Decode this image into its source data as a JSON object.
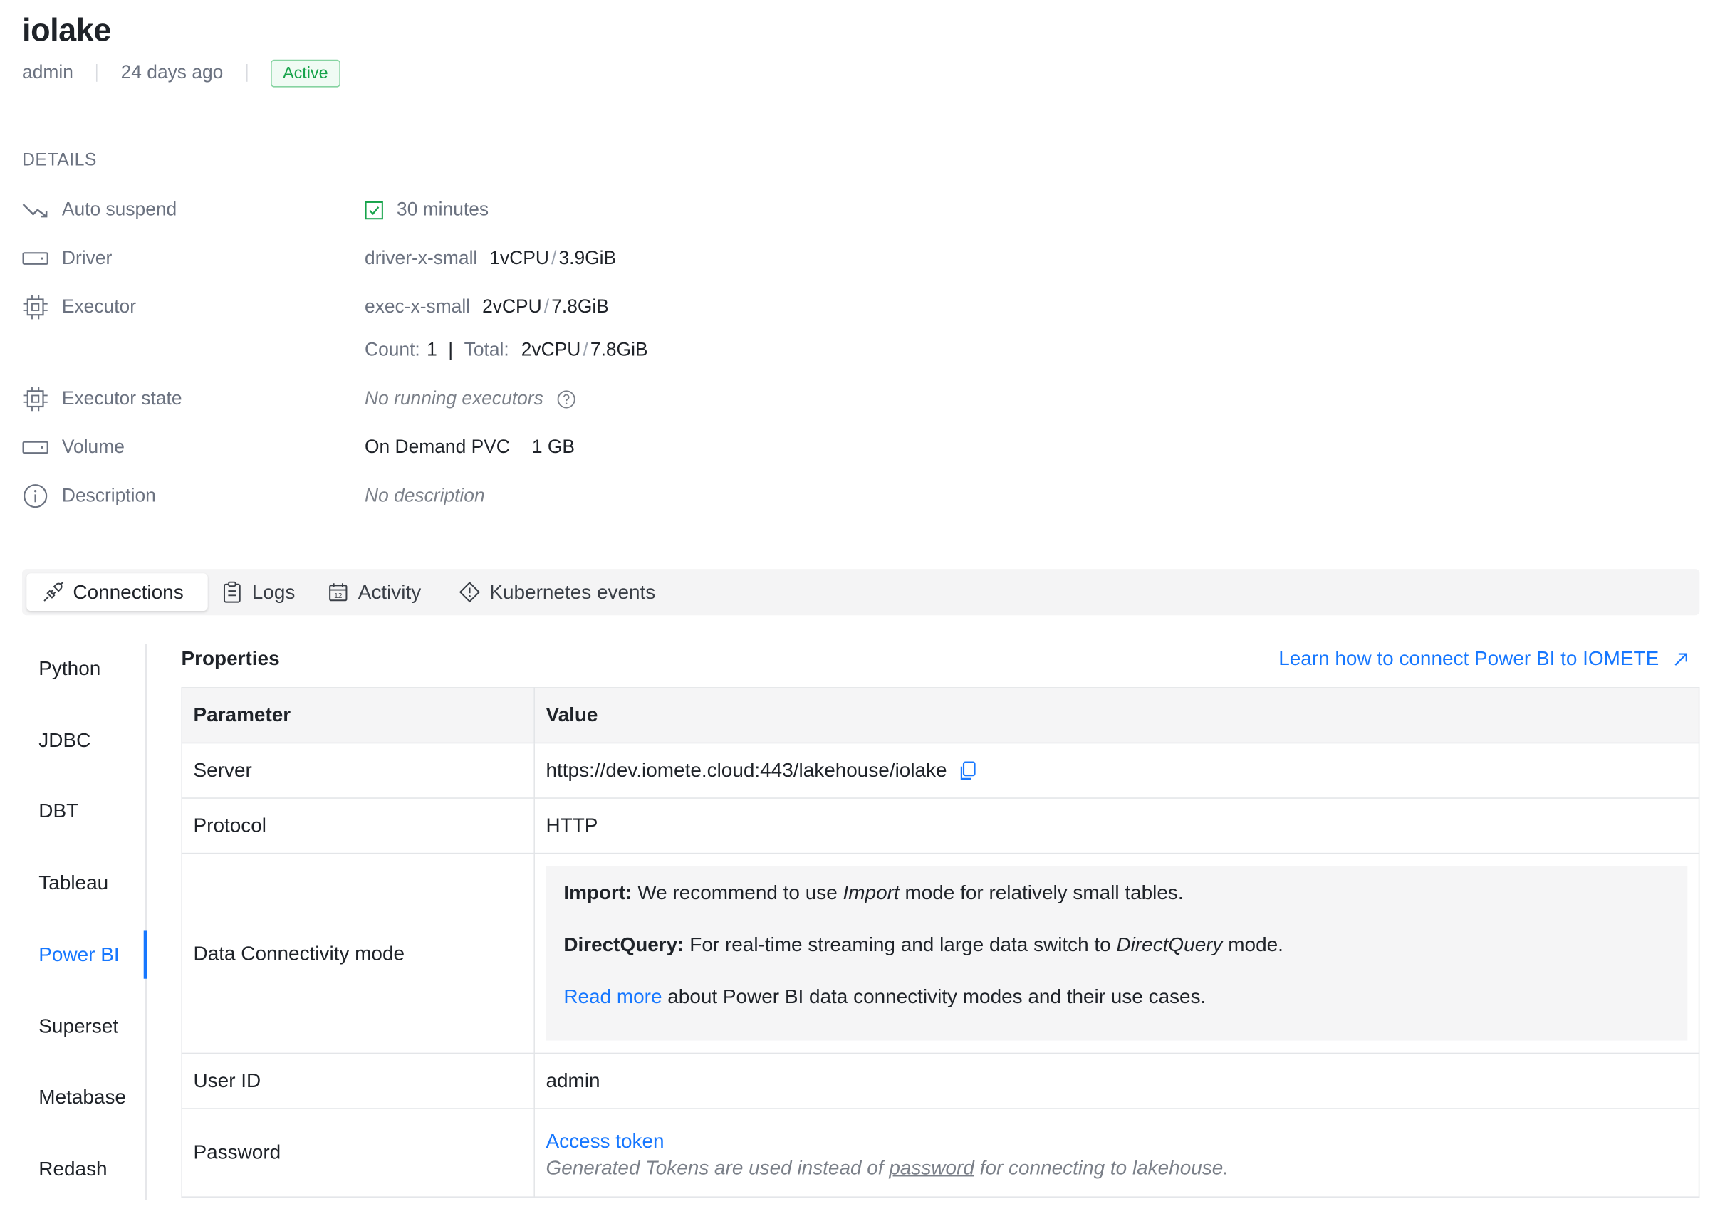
{
  "header": {
    "title": "iolake",
    "owner": "admin",
    "created": "24 days ago",
    "status": "Active"
  },
  "details": {
    "heading": "DETAILS",
    "auto_suspend": {
      "label": "Auto suspend",
      "value": "30 minutes"
    },
    "driver": {
      "label": "Driver",
      "type": "driver-x-small",
      "cpu": "1vCPU",
      "sep": "/",
      "mem": "3.9GiB"
    },
    "executor": {
      "label": "Executor",
      "type": "exec-x-small",
      "cpu": "2vCPU",
      "sep": "/",
      "mem": "7.8GiB",
      "count_label": "Count:",
      "count": "1",
      "divider": "|",
      "total_label": "Total:",
      "total_cpu": "2vCPU",
      "total_mem": "7.8GiB"
    },
    "executor_state": {
      "label": "Executor state",
      "value": "No running executors"
    },
    "volume": {
      "label": "Volume",
      "type": "On Demand PVC",
      "size": "1 GB"
    },
    "description": {
      "label": "Description",
      "value": "No description"
    }
  },
  "tabs": [
    {
      "label": "Connections",
      "active": true
    },
    {
      "label": "Logs"
    },
    {
      "label": "Activity"
    },
    {
      "label": "Kubernetes events"
    }
  ],
  "sidebar": {
    "items": [
      "Python",
      "JDBC",
      "DBT",
      "Tableau",
      "Power BI",
      "Superset",
      "Metabase",
      "Redash"
    ],
    "active": "Power BI"
  },
  "properties": {
    "title": "Properties",
    "learn_link": "Learn how to connect Power BI to IOMETE",
    "columns": [
      "Parameter",
      "Value"
    ],
    "server": {
      "label": "Server",
      "value": "https://dev.iomete.cloud:443/lakehouse/iolake"
    },
    "protocol": {
      "label": "Protocol",
      "value": "HTTP"
    },
    "mode": {
      "label": "Data Connectivity mode",
      "import_bold": "Import:",
      "import_pre": "We recommend to use",
      "import_em": "Import",
      "import_post": "mode for relatively small tables.",
      "dq_bold": "DirectQuery:",
      "dq_pre": "For real-time streaming and large data switch to",
      "dq_em": "DirectQuery",
      "dq_post": "mode.",
      "read_more": "Read more",
      "read_more_rest": "about Power BI data connectivity modes and their use cases."
    },
    "user_id": {
      "label": "User ID",
      "value": "admin"
    },
    "password": {
      "label": "Password",
      "link": "Access token",
      "note_pre": "Generated Tokens are used instead of",
      "note_link": "password",
      "note_post": "for connecting to lakehouse."
    }
  }
}
